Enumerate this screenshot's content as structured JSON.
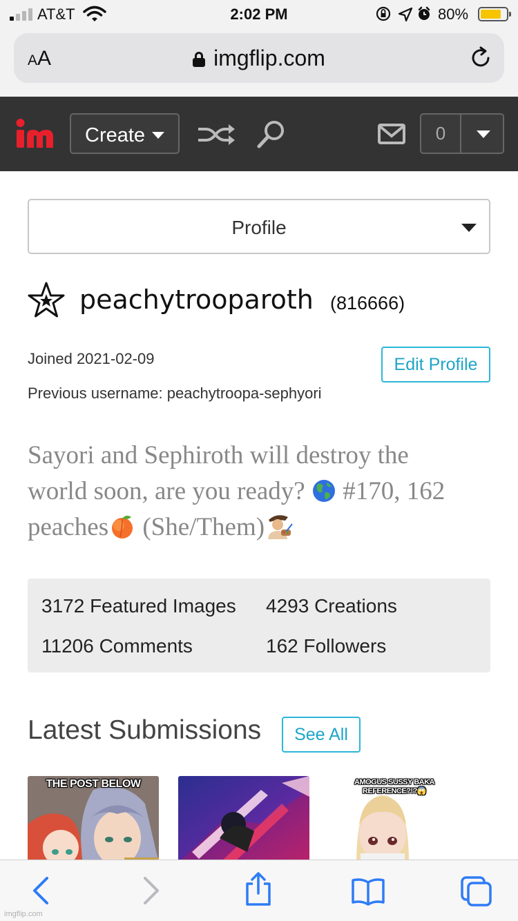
{
  "status_bar": {
    "carrier": "AT&T",
    "time": "2:02 PM",
    "battery_percent": "80%",
    "battery_level": 0.8,
    "signal_bars": 1,
    "battery_color": "#f7c500"
  },
  "browser": {
    "text_size_label_small": "A",
    "text_size_label_large": "A",
    "domain": "imgflip.com"
  },
  "nav": {
    "create_label": "Create",
    "notification_count": "0",
    "icons": [
      "imgflip-logo",
      "shuffle-icon",
      "search-icon",
      "mail-icon",
      "chevron-down-icon"
    ]
  },
  "profile": {
    "section_select": "Profile",
    "username": "peachytrooparoth",
    "points": "(816666)",
    "joined": "Joined 2021-02-09",
    "previous_username": "Previous username: peachytroopa-sephyori",
    "edit_label": "Edit Profile",
    "bio_line1": "Sayori and Sephiroth will destroy the",
    "bio_line2_a": "world soon, are you ready?",
    "bio_line2_b": "#170, 162",
    "bio_line3_a": "peaches",
    "bio_line3_b": "(She/Them)",
    "bio_emojis": [
      "globe-emoji",
      "peach-emoji",
      "artist-emoji"
    ]
  },
  "stats": {
    "featured": "3172 Featured Images",
    "creations": "4293 Creations",
    "comments": "11206 Comments",
    "followers": "162 Followers"
  },
  "latest": {
    "title": "Latest Submissions",
    "see_all": "See All",
    "thumbnails": [
      {
        "caption": "THE POST BELOW"
      },
      {
        "caption": ""
      },
      {
        "caption": "AMOGUS SUSSY BAKA REFERENCE?!?😱"
      }
    ]
  },
  "toolbar": {
    "icons": [
      "back-icon",
      "forward-icon",
      "share-icon",
      "bookmarks-icon",
      "tabs-icon"
    ]
  },
  "watermark": "imgflip.com",
  "colors": {
    "nav_bg": "#333333",
    "accent": "#2bb7d8",
    "logo_red": "#e8202c",
    "ios_blue": "#2e7cf6"
  }
}
